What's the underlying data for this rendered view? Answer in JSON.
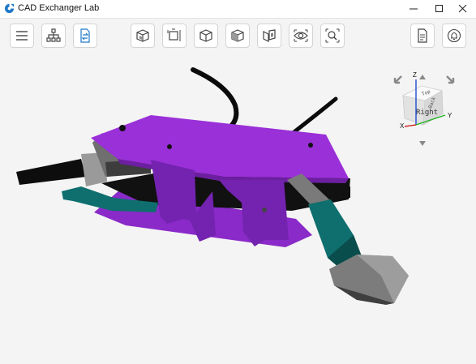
{
  "window": {
    "title": "CAD Exchanger Lab",
    "controls": [
      "minimize",
      "maximize",
      "close"
    ]
  },
  "toolbar": {
    "left": [
      "menu-icon",
      "structure-tree-icon",
      "import-export-icon"
    ],
    "center": [
      "view-front-icon",
      "view-dimension-icon",
      "view-iso-icon",
      "view-section-icon",
      "view-exploded-icon",
      "visibility-icon",
      "zoom-fit-icon"
    ],
    "right": [
      "properties-icon",
      "notifications-icon"
    ]
  },
  "view_cube": {
    "face_label": "Right",
    "top_label": "Top",
    "side_label": "Back",
    "axes": {
      "z": "Z",
      "x": "X",
      "y": "Y"
    }
  },
  "colors": {
    "purple": "#9a30d8",
    "teal": "#0f6e6e",
    "gray": "#8a8a8a",
    "black": "#0b0b0b"
  }
}
